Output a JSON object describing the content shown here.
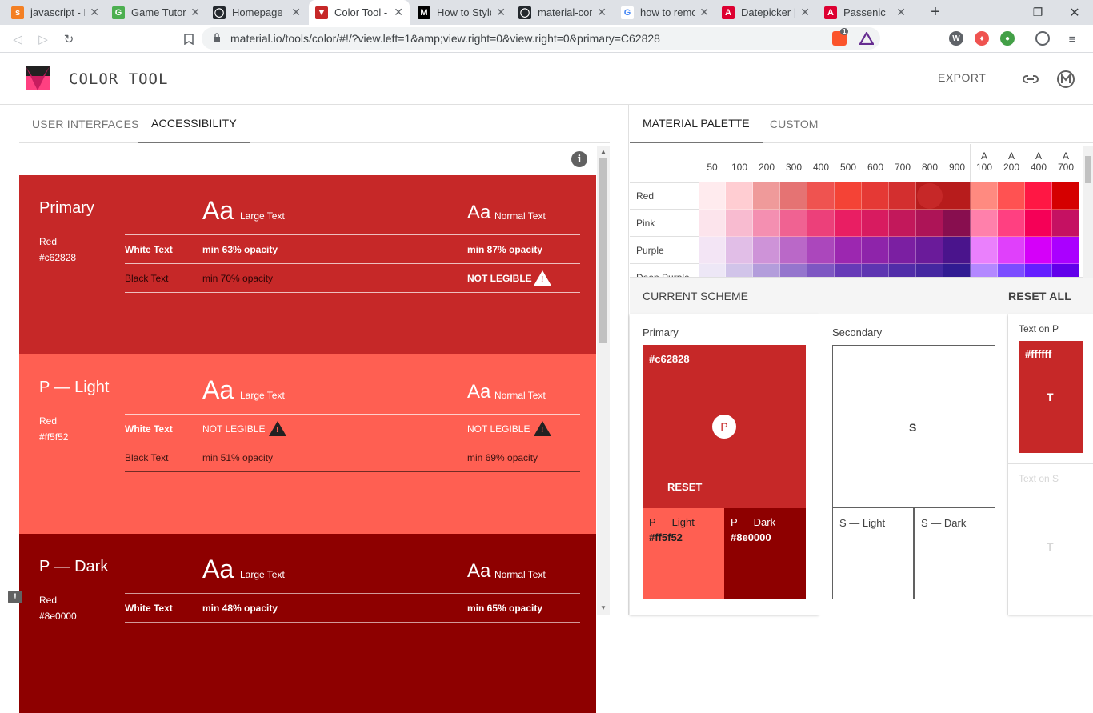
{
  "browser": {
    "tabs": [
      {
        "title": "javascript - Bo",
        "fav_color": "#f48024",
        "fav": "s"
      },
      {
        "title": "Game Tutoria",
        "fav_color": "#4caf50",
        "fav": "G"
      },
      {
        "title": "Homepage - ",
        "fav_color": "#24292e",
        "fav": "◯"
      },
      {
        "title": "Color Tool - M",
        "fav_color": "#c62828",
        "fav": "▼"
      },
      {
        "title": "How to Style",
        "fav_color": "#000000",
        "fav": "M"
      },
      {
        "title": "material-com",
        "fav_color": "#24292e",
        "fav": "◯"
      },
      {
        "title": "how to remo",
        "fav_color": "#ffffff",
        "fav": "G"
      },
      {
        "title": "Datepicker | A",
        "fav_color": "#dd0031",
        "fav": "A"
      },
      {
        "title": "Passenic",
        "fav_color": "#dd0031",
        "fav": "A"
      }
    ],
    "url": "material.io/tools/color/#!/?view.left=1&amp;view.right=0&view.right=0&primary=C62828",
    "brave_badge": "1"
  },
  "header": {
    "title": "COLOR TOOL",
    "export_label": "EXPORT"
  },
  "left_tabs": [
    "USER INTERFACES",
    "ACCESSIBILITY"
  ],
  "aa": "Aa",
  "large_text": "Large Text",
  "normal_text": "Normal Text",
  "white_text": "White Text",
  "black_text": "Black Text",
  "cards": [
    {
      "name": "Primary",
      "color_name": "Red",
      "hex": "#c62828",
      "bg": "#c62828",
      "white_large": "min 63% opacity",
      "white_normal": "min 87% opacity",
      "black_large": "min 70% opacity",
      "black_normal": "NOT LEGIBLE"
    },
    {
      "name": "P — Light",
      "color_name": "Red",
      "hex": "#ff5f52",
      "bg": "#ff5f52",
      "white_large": "NOT LEGIBLE",
      "white_normal": "NOT LEGIBLE",
      "black_large": "min 51% opacity",
      "black_normal": "min 69% opacity"
    },
    {
      "name": "P — Dark",
      "color_name": "Red",
      "hex": "#8e0000",
      "bg": "#8e0000",
      "white_large": "min 48% opacity",
      "white_normal": "min 65% opacity",
      "black_large": "",
      "black_normal": ""
    }
  ],
  "right_tabs": [
    "MATERIAL PALETTE",
    "CUSTOM"
  ],
  "palette": {
    "columns": [
      {
        "top": "",
        "bottom": "50"
      },
      {
        "top": "",
        "bottom": "100"
      },
      {
        "top": "",
        "bottom": "200"
      },
      {
        "top": "",
        "bottom": "300"
      },
      {
        "top": "",
        "bottom": "400"
      },
      {
        "top": "",
        "bottom": "500"
      },
      {
        "top": "",
        "bottom": "600"
      },
      {
        "top": "",
        "bottom": "700"
      },
      {
        "top": "",
        "bottom": "800"
      },
      {
        "top": "",
        "bottom": "900"
      },
      {
        "top": "A",
        "bottom": "100"
      },
      {
        "top": "A",
        "bottom": "200"
      },
      {
        "top": "A",
        "bottom": "400"
      },
      {
        "top": "A",
        "bottom": "700"
      }
    ],
    "rows": [
      {
        "name": "Red",
        "colors": [
          "#ffebee",
          "#ffcdd2",
          "#ef9a9a",
          "#e57373",
          "#ef5350",
          "#f44336",
          "#e53935",
          "#d32f2f",
          "#c62828",
          "#b71c1c",
          "#ff8a80",
          "#ff5252",
          "#ff1744",
          "#d50000"
        ]
      },
      {
        "name": "Pink",
        "colors": [
          "#fce4ec",
          "#f8bbd0",
          "#f48fb1",
          "#f06292",
          "#ec407a",
          "#e91e63",
          "#d81b60",
          "#c2185b",
          "#ad1457",
          "#880e4f",
          "#ff80ab",
          "#ff4081",
          "#f50057",
          "#c51162"
        ]
      },
      {
        "name": "Purple",
        "colors": [
          "#f3e5f5",
          "#e1bee7",
          "#ce93d8",
          "#ba68c8",
          "#ab47bc",
          "#9c27b0",
          "#8e24aa",
          "#7b1fa2",
          "#6a1b9a",
          "#4a148c",
          "#ea80fc",
          "#e040fb",
          "#d500f9",
          "#aa00ff"
        ]
      },
      {
        "name": "Deep Purple",
        "colors": [
          "#ede7f6",
          "#d1c4e9",
          "#b39ddb",
          "#9575cd",
          "#7e57c2",
          "#673ab7",
          "#5e35b1",
          "#512da8",
          "#4527a0",
          "#311b92",
          "#b388ff",
          "#7c4dff",
          "#651fff",
          "#6200ea"
        ]
      }
    ]
  },
  "scheme": {
    "label": "CURRENT SCHEME",
    "reset_all": "RESET ALL",
    "primary_label": "Primary",
    "primary_hex": "#c62828",
    "p_badge": "P",
    "reset": "RESET",
    "p_light_label": "P — Light",
    "p_light_hex": "#ff5f52",
    "p_dark_label": "P — Dark",
    "p_dark_hex": "#8e0000",
    "secondary_label": "Secondary",
    "s_badge": "S",
    "s_light_label": "S — Light",
    "s_dark_label": "S — Dark",
    "text_on_p_label": "Text on P",
    "text_on_p_hex": "#ffffff",
    "t_badge": "T",
    "text_on_s_label": "Text on S",
    "t_badge_s": "T"
  }
}
